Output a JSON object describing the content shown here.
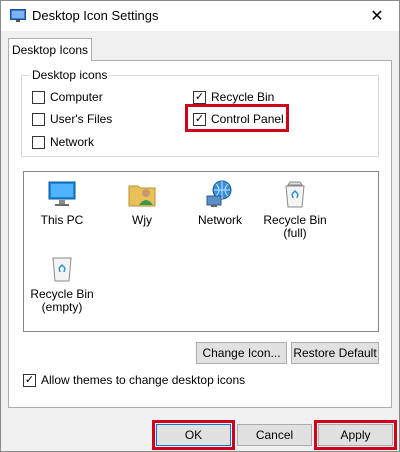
{
  "window": {
    "title": "Desktop Icon Settings",
    "close_glyph": "✕"
  },
  "tabs": [
    {
      "label": "Desktop Icons",
      "selected": true
    }
  ],
  "desktop_icons_group": {
    "legend": "Desktop icons",
    "checkboxes": [
      {
        "label": "Computer",
        "checked": false
      },
      {
        "label": "User's Files",
        "checked": false
      },
      {
        "label": "Network",
        "checked": false
      },
      {
        "label": "Recycle Bin",
        "checked": true
      },
      {
        "label": "Control Panel",
        "checked": true,
        "highlighted": true
      }
    ]
  },
  "icon_list": [
    {
      "label": "This PC",
      "icon": "this-pc-icon"
    },
    {
      "label": "Wjy",
      "icon": "user-folder-icon"
    },
    {
      "label": "Network",
      "icon": "network-icon"
    },
    {
      "label": "Recycle Bin\n(full)",
      "icon": "recycle-bin-full-icon"
    },
    {
      "label": "Recycle Bin\n(empty)",
      "icon": "recycle-bin-empty-icon"
    }
  ],
  "icon_buttons": {
    "change_icon": "Change Icon...",
    "restore_default": "Restore Default"
  },
  "themes_checkbox": {
    "label": "Allow themes to change desktop icons",
    "checked": true
  },
  "footer_buttons": {
    "ok": "OK",
    "cancel": "Cancel",
    "apply": "Apply"
  },
  "colors": {
    "highlight": "#d0021b",
    "accent": "#0078d7"
  }
}
